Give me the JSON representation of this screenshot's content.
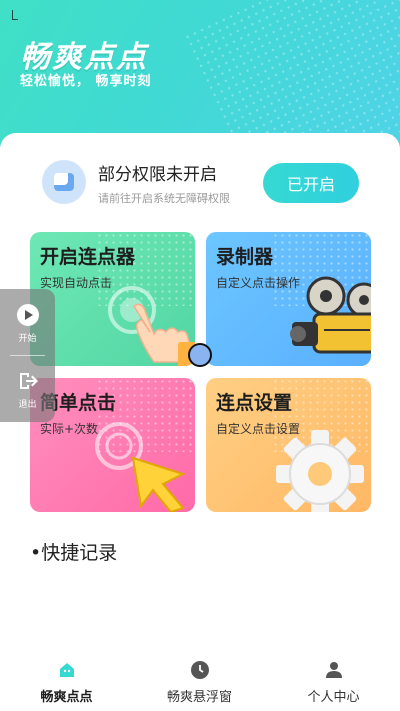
{
  "header": {
    "title": "畅爽点点",
    "subtitle": "轻松愉悦， 畅享时刻"
  },
  "permission": {
    "title": "部分权限未开启",
    "description": "请前往开启系统无障碍权限",
    "button_label": "已开启"
  },
  "tiles": [
    {
      "title": "开启连点器",
      "description": "实现自动点击"
    },
    {
      "title": "录制器",
      "description": "自定义点击操作"
    },
    {
      "title": "简单点击",
      "description": "实际+次数"
    },
    {
      "title": "连点设置",
      "description": "自定义点击设置"
    }
  ],
  "quick_records": {
    "title": "•快捷记录"
  },
  "floating_panel": {
    "start_label": "开始",
    "exit_label": "退出"
  },
  "tabbar": {
    "items": [
      {
        "label": "畅爽点点",
        "icon": "home-icon",
        "active": true
      },
      {
        "label": "畅爽悬浮窗",
        "icon": "clock-icon",
        "active": false
      },
      {
        "label": "个人中心",
        "icon": "person-icon",
        "active": false
      }
    ]
  },
  "colors": {
    "accent": "#36d9d2",
    "tile_green": "#52d6a4",
    "tile_blue": "#5ab0ff",
    "tile_pink": "#ff6aa8",
    "tile_orange": "#ffb865"
  }
}
